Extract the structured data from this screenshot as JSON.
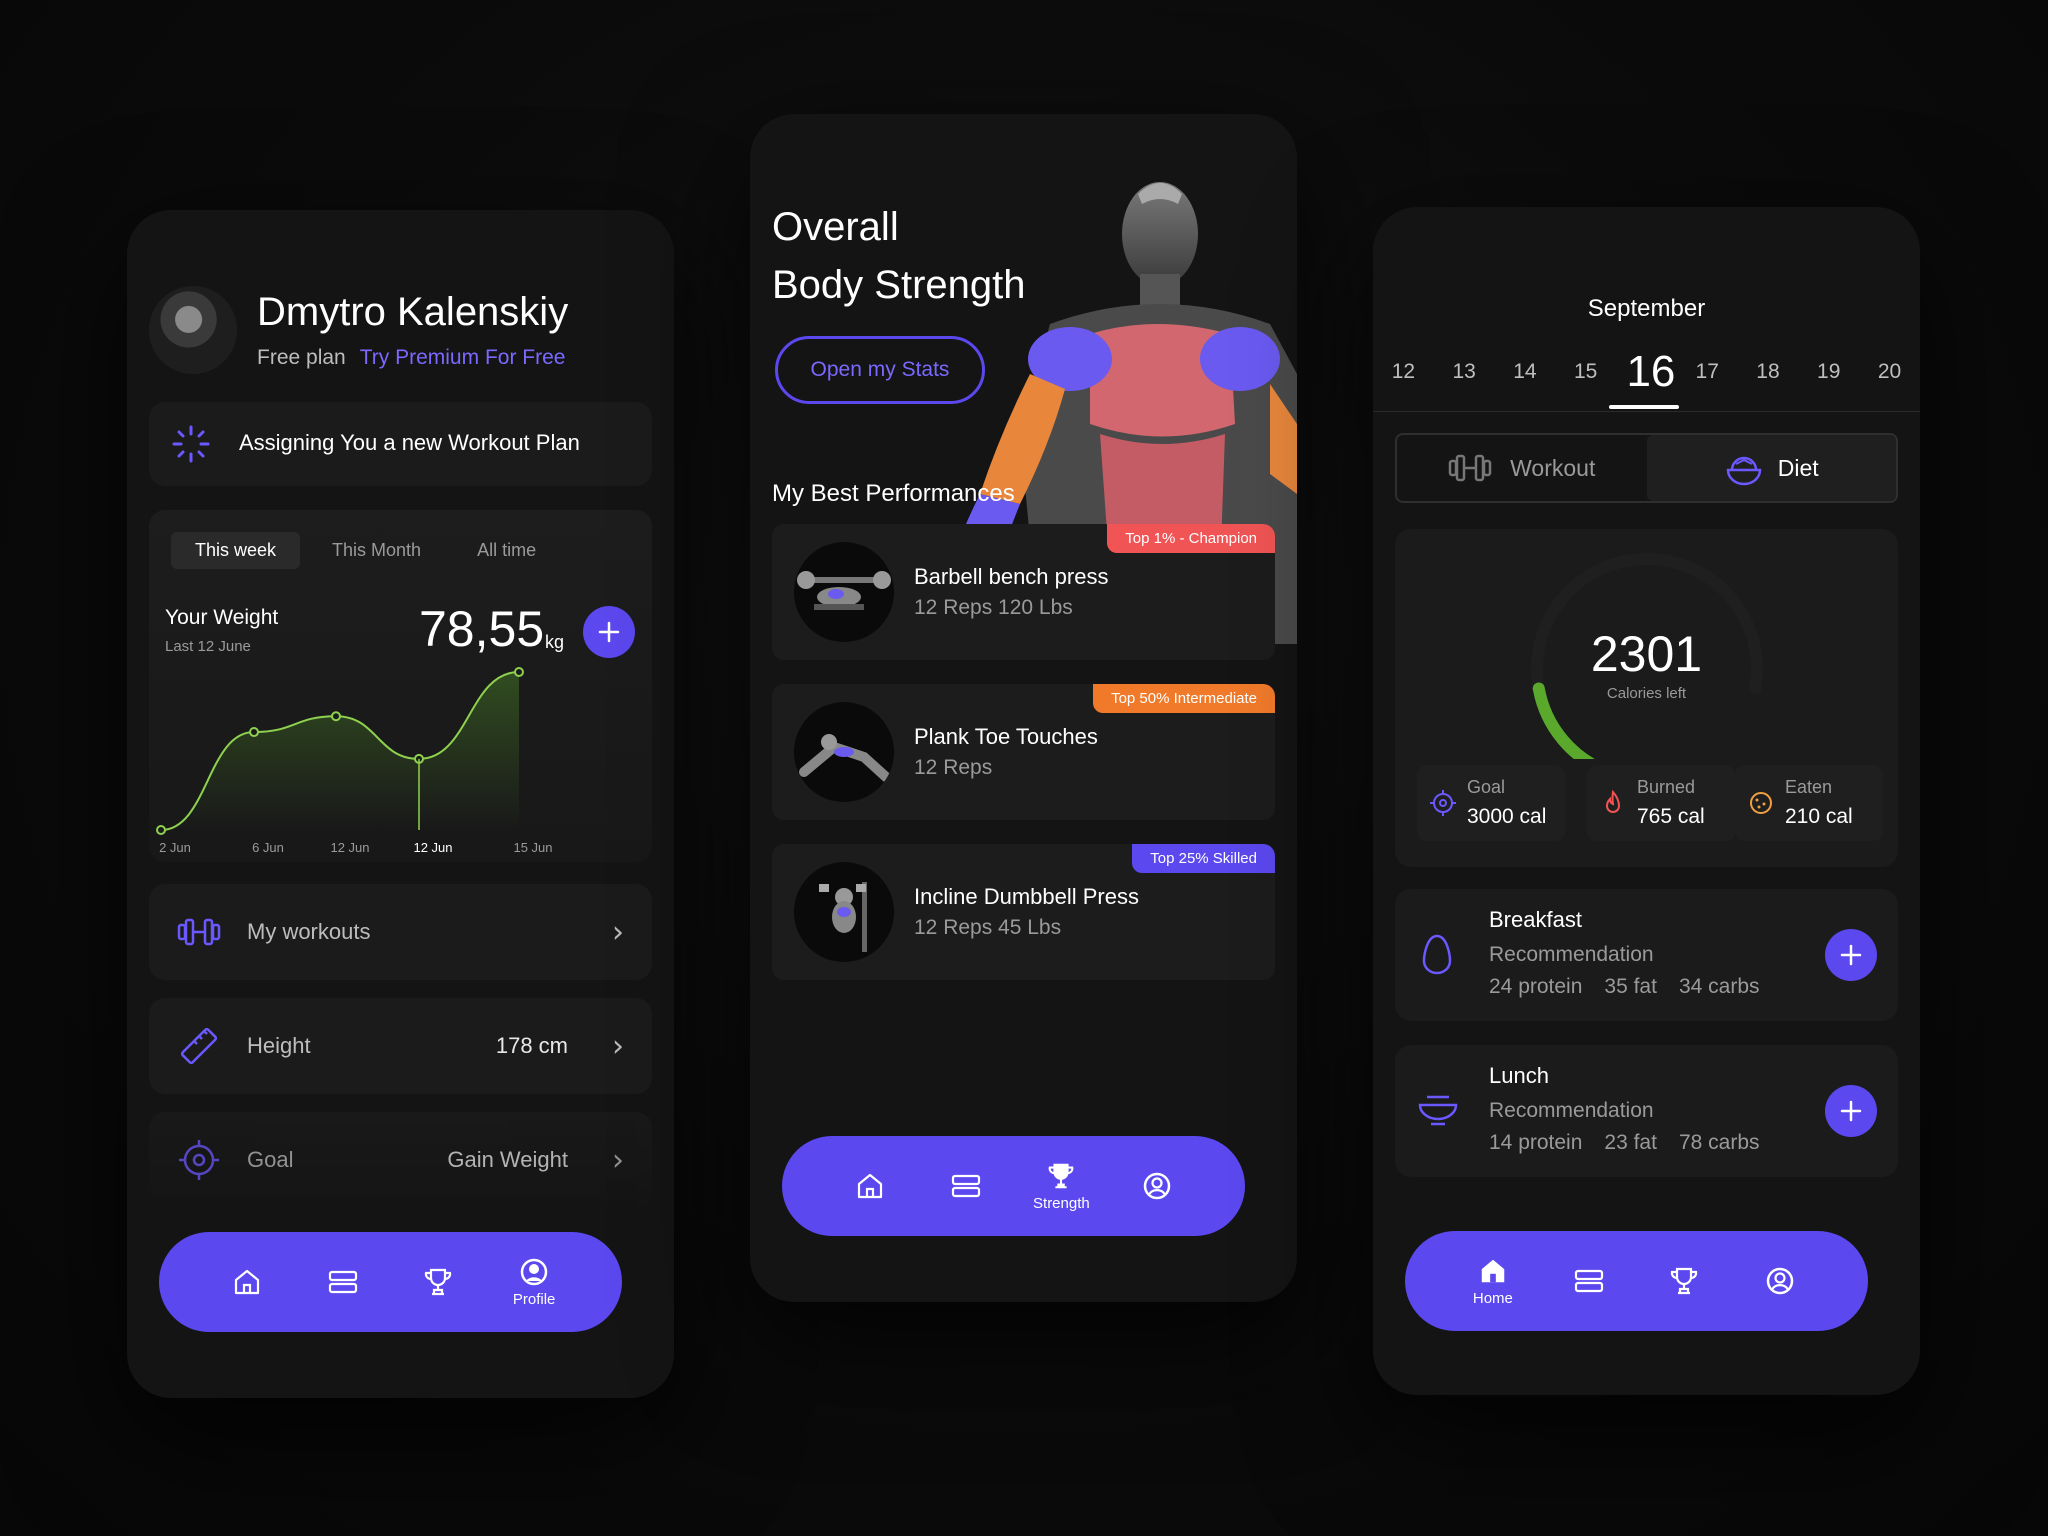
{
  "colors": {
    "accent": "#5b48ee",
    "green": "#5aa92c",
    "champion": "#f05454",
    "intermediate": "#f07a2a",
    "skilled": "#5b48ee"
  },
  "profile": {
    "name": "Dmytro Kalenskiy",
    "plan": "Free plan",
    "premium_link": "Try Premium For Free",
    "assign_text": "Assigning You a new Workout Plan",
    "tabs": [
      "This week",
      "This Month",
      "All time"
    ],
    "weight_label": "Your Weight",
    "weight_date": "Last 12 June",
    "weight_value": "78,55",
    "weight_unit": "kg",
    "chart_data": {
      "type": "line",
      "x": [
        "2 Jun",
        "6 Jun",
        "12 Jun",
        "12 Jun",
        "15 Jun"
      ],
      "values": [
        0,
        0.62,
        0.72,
        0.45,
        1.0
      ],
      "xlabel": "",
      "ylabel": "",
      "tick_labels": [
        "2 Jun",
        "6 Jun",
        "12 Jun",
        "12 Jun",
        "15 Jun"
      ]
    },
    "rows": [
      {
        "label": "My workouts",
        "value": "",
        "icon": "dumbbell-icon"
      },
      {
        "label": "Height",
        "value": "178 cm",
        "icon": "ruler-icon"
      },
      {
        "label": "Goal",
        "value": "Gain Weight",
        "icon": "target-icon"
      }
    ],
    "nav": {
      "active_label": "Profile"
    }
  },
  "strength": {
    "title_line1": "Overall",
    "title_line2": "Body Strength",
    "button": "Open my Stats",
    "section": "My Best Performances",
    "items": [
      {
        "title": "Barbell bench press",
        "sub": "12 Reps 120 Lbs",
        "badge": "Top 1% - Champion"
      },
      {
        "title": "Plank Toe Touches",
        "sub": "12 Reps",
        "badge": "Top 50% Intermediate"
      },
      {
        "title": "Incline Dumbbell Press",
        "sub": "12 Reps 45 Lbs",
        "badge": "Top 25% Skilled"
      }
    ],
    "nav": {
      "active_label": "Strength"
    }
  },
  "diet": {
    "month": "September",
    "days": [
      "12",
      "13",
      "14",
      "15",
      "16",
      "17",
      "18",
      "19",
      "20"
    ],
    "selected_day": "16",
    "toggle": {
      "workout": "Workout",
      "diet": "Diet"
    },
    "calories": "2301",
    "calories_label": "Calories left",
    "calories_progress": 0.23,
    "stats": [
      {
        "label": "Goal",
        "value": "3000 cal",
        "icon": "target-icon"
      },
      {
        "label": "Burned",
        "value": "765 cal",
        "icon": "flame-icon"
      },
      {
        "label": "Eaten",
        "value": "210 cal",
        "icon": "cookie-icon"
      }
    ],
    "meals": [
      {
        "title": "Breakfast",
        "rec": "Recommendation",
        "protein": "24 protein",
        "fat": "35 fat",
        "carbs": "34 carbs"
      },
      {
        "title": "Lunch",
        "rec": "Recommendation",
        "protein": "14 protein",
        "fat": "23 fat",
        "carbs": "78 carbs"
      }
    ],
    "nav": {
      "active_label": "Home"
    }
  }
}
